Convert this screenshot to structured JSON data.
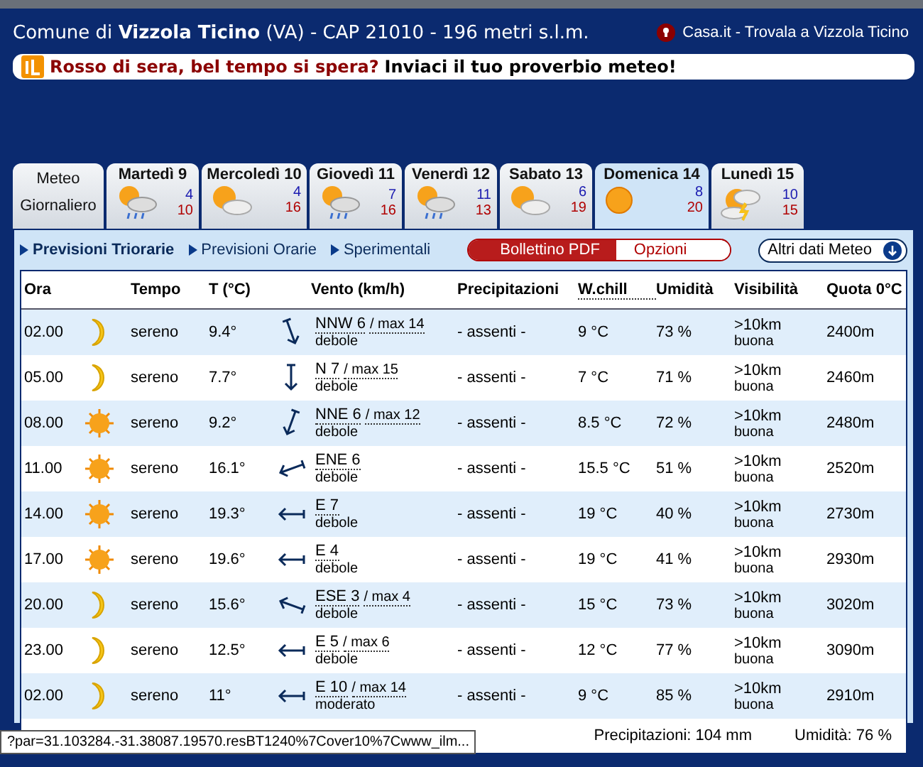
{
  "header": {
    "title_prefix": "Comune di",
    "title_name": "Vizzola Ticino",
    "title_rest": "(VA) - CAP 21010 - 196 metri s.l.m.",
    "link": "Casa.it - Trovala a Vizzola Ticino"
  },
  "banner": {
    "question": "Rosso di sera, bel tempo si spera?",
    "call": "Inviaci il tuo proverbio meteo!"
  },
  "tabs": [
    {
      "label": "Meteo Giornaliero",
      "selected": false,
      "kind": "text"
    },
    {
      "label": "Martedì 9",
      "min": "4",
      "max": "10",
      "kind": "sun-cloud-rain",
      "selected": false
    },
    {
      "label": "Mercoledì 10",
      "min": "4",
      "max": "16",
      "kind": "sun-cloud",
      "selected": false
    },
    {
      "label": "Giovedì 11",
      "min": "7",
      "max": "16",
      "kind": "sun-cloud-rain",
      "selected": false
    },
    {
      "label": "Venerdì 12",
      "min": "11",
      "max": "13",
      "kind": "sun-cloud-rain",
      "selected": false
    },
    {
      "label": "Sabato 13",
      "min": "6",
      "max": "19",
      "kind": "sun-cloud",
      "selected": false
    },
    {
      "label": "Domenica 14",
      "min": "8",
      "max": "20",
      "kind": "sun",
      "selected": true
    },
    {
      "label": "Lunedì 15",
      "min": "10",
      "max": "15",
      "kind": "sun-cloud-storm",
      "selected": false
    }
  ],
  "subnav": [
    {
      "label": "Previsioni Triorarie",
      "selected": true
    },
    {
      "label": "Previsioni Orarie",
      "selected": false
    },
    {
      "label": "Sperimentali",
      "selected": false
    }
  ],
  "pdf_button": "Bollettino PDF",
  "options_button": "Opzioni",
  "more_button": "Altri dati Meteo",
  "table": {
    "columns": [
      "Ora",
      "Tempo",
      "T (°C)",
      "Vento (km/h)",
      "Precipitazioni",
      "W.chill",
      "Umidità",
      "Visibilità",
      "Quota 0°C"
    ],
    "rows": [
      {
        "time": "02.00",
        "kind": "moon",
        "sky": "sereno",
        "temp": "9.4°",
        "wind": {
          "kind": "nnw",
          "speed": "NNW 6",
          "gust": "/ max 14",
          "strength": "debole"
        },
        "precip": "- assenti -",
        "chill": "9 °C",
        "humidity": "73 %",
        "vis": ">10km",
        "vis_desc": "buona",
        "freezing": "2400m"
      },
      {
        "time": "05.00",
        "kind": "moon",
        "sky": "sereno",
        "temp": "7.7°",
        "wind": {
          "kind": "n",
          "speed": "N 7",
          "gust": "/ max 15",
          "strength": "debole"
        },
        "precip": "- assenti -",
        "chill": "7 °C",
        "humidity": "71 %",
        "vis": ">10km",
        "vis_desc": "buona",
        "freezing": "2460m"
      },
      {
        "time": "08.00",
        "kind": "sun",
        "sky": "sereno",
        "temp": "9.2°",
        "wind": {
          "kind": "nne",
          "speed": "NNE 6",
          "gust": "/ max 12",
          "strength": "debole"
        },
        "precip": "- assenti -",
        "chill": "8.5 °C",
        "humidity": "72 %",
        "vis": ">10km",
        "vis_desc": "buona",
        "freezing": "2480m"
      },
      {
        "time": "11.00",
        "kind": "sun",
        "sky": "sereno",
        "temp": "16.1°",
        "wind": {
          "kind": "ene",
          "speed": "ENE 6",
          "strength": "debole"
        },
        "precip": "- assenti -",
        "chill": "15.5 °C",
        "humidity": "51 %",
        "vis": ">10km",
        "vis_desc": "buona",
        "freezing": "2520m"
      },
      {
        "time": "14.00",
        "kind": "sun",
        "sky": "sereno",
        "temp": "19.3°",
        "wind": {
          "kind": "e",
          "speed": "E 7",
          "strength": "debole"
        },
        "precip": "- assenti -",
        "chill": "19 °C",
        "humidity": "40 %",
        "vis": ">10km",
        "vis_desc": "buona",
        "freezing": "2730m"
      },
      {
        "time": "17.00",
        "kind": "sun",
        "sky": "sereno",
        "temp": "19.6°",
        "wind": {
          "kind": "e",
          "speed": "E 4",
          "strength": "debole"
        },
        "precip": "- assenti -",
        "chill": "19 °C",
        "humidity": "41 %",
        "vis": ">10km",
        "vis_desc": "buona",
        "freezing": "2930m"
      },
      {
        "time": "20.00",
        "kind": "moon",
        "sky": "sereno",
        "temp": "15.6°",
        "wind": {
          "kind": "ese",
          "speed": "ESE 3",
          "gust": "/ max 4",
          "strength": "debole"
        },
        "precip": "- assenti -",
        "chill": "15 °C",
        "humidity": "73 %",
        "vis": ">10km",
        "vis_desc": "buona",
        "freezing": "3020m"
      },
      {
        "time": "23.00",
        "kind": "moon",
        "sky": "sereno",
        "temp": "12.5°",
        "wind": {
          "kind": "e",
          "speed": "E 5",
          "gust": "/ max 6",
          "strength": "debole"
        },
        "precip": "- assenti -",
        "chill": "12 °C",
        "humidity": "77 %",
        "vis": ">10km",
        "vis_desc": "buona",
        "freezing": "3090m"
      },
      {
        "time": "02.00",
        "kind": "moon",
        "sky": "sereno",
        "temp": "11°",
        "wind": {
          "kind": "e",
          "speed": "E 10",
          "gust": "/ max 14",
          "strength": "moderato"
        },
        "precip": "- assenti -",
        "chill": "9 °C",
        "humidity": "85 %",
        "vis": ">10km",
        "vis_desc": "buona",
        "freezing": "2910m"
      }
    ]
  },
  "summary": {
    "precip": "Precipitazioni: 104 mm",
    "humidity": "Umidità: 76 %"
  },
  "status_tooltip": "?par=31.103284.-31.38087.19570.resBT1240%7Cover10%7Cwww_ilm..."
}
